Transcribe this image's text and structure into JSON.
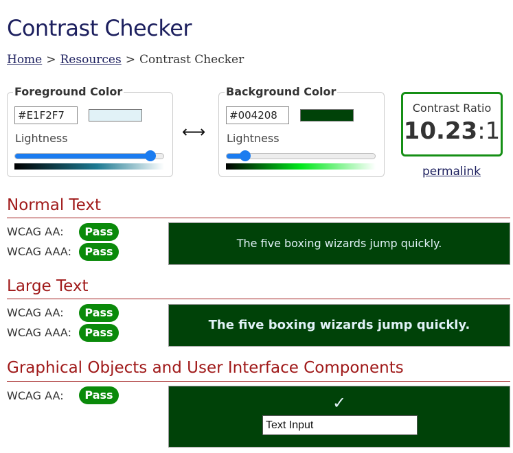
{
  "page": {
    "title": "Contrast Checker"
  },
  "breadcrumb": {
    "home": "Home",
    "resources": "Resources",
    "current": "Contrast Checker",
    "separator": ">"
  },
  "foreground": {
    "legend": "Foreground Color",
    "hex": "#E1F2F7",
    "swatch_color": "#E1F2F7",
    "lightness_label": "Lightness",
    "lightness_percent": 91
  },
  "background": {
    "legend": "Background Color",
    "hex": "#004208",
    "swatch_color": "#004208",
    "lightness_label": "Lightness",
    "lightness_percent": 13
  },
  "swap_icon": "left-right-arrow-icon",
  "ratio": {
    "label": "Contrast Ratio",
    "value": "10.23",
    "suffix": ":1",
    "permalink": "permalink"
  },
  "sections": {
    "normal": {
      "title": "Normal Text",
      "aa_label": "WCAG AA:",
      "aa_result": "Pass",
      "aaa_label": "WCAG AAA:",
      "aaa_result": "Pass",
      "sample": "The five boxing wizards jump quickly."
    },
    "large": {
      "title": "Large Text",
      "aa_label": "WCAG AA:",
      "aa_result": "Pass",
      "aaa_label": "WCAG AAA:",
      "aaa_result": "Pass",
      "sample": "The five boxing wizards jump quickly."
    },
    "graphics": {
      "title": "Graphical Objects and User Interface Components",
      "aa_label": "WCAG AA:",
      "aa_result": "Pass",
      "check_symbol": "✓",
      "input_value": "Text Input"
    }
  },
  "colors": {
    "title": "#1c1f5e",
    "section": "#a01a1a",
    "pass": "#0a8a0a",
    "slider": "#1b7cf0",
    "ratio_border": "#158f15"
  }
}
